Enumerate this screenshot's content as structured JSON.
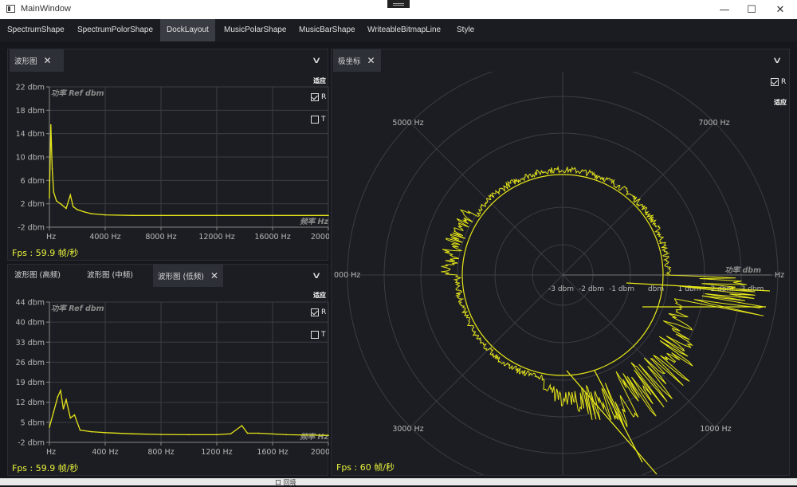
{
  "window": {
    "title": "MainWindow",
    "minimize_glyph": "—",
    "maximize_glyph": "☐",
    "close_glyph": "✕"
  },
  "menu": {
    "items": [
      {
        "label": "SpectrumShape",
        "active": false
      },
      {
        "label": "SpectrumPolorShape",
        "active": false
      },
      {
        "label": "DockLayout",
        "active": true
      },
      {
        "label": "MusicPolarShape",
        "active": false
      },
      {
        "label": "MusicBarShape",
        "active": false
      },
      {
        "label": "WriteableBitmapLine",
        "active": false
      },
      {
        "label": "Style",
        "active": false
      }
    ]
  },
  "dock": {
    "top_left": {
      "tab_label": "波形图",
      "fit_label": "适应",
      "check_r": {
        "label": "R",
        "checked": true
      },
      "check_t": {
        "label": "T",
        "checked": false
      },
      "fps_text": "Fps : 59.9 帧/秒"
    },
    "bottom_left": {
      "tabs": [
        {
          "label": "波形图 (高频)",
          "active": false
        },
        {
          "label": "波形图 (中频)",
          "active": false
        },
        {
          "label": "波形图 (低频)",
          "active": true
        }
      ],
      "fit_label": "适应",
      "check_r": {
        "label": "R",
        "checked": true
      },
      "check_t": {
        "label": "T",
        "checked": false
      },
      "fps_text": "Fps : 59.9 帧/秒"
    },
    "right": {
      "tab_label": "极坐标",
      "fit_label": "适应",
      "check_r": {
        "label": "R",
        "checked": true
      },
      "fps_text": "Fps : 60 帧/秒"
    }
  },
  "taskbar": {
    "text": "口 回境"
  },
  "colors": {
    "trace": "#e6e619",
    "fps": "#e7f23c",
    "grid": "#3b3d44",
    "axis_text": "#b8b8b8"
  },
  "chart_data": [
    {
      "type": "line",
      "ylabel": "功率 Ref dbm",
      "xlabel": "频率 Hz",
      "y_ticks": [
        "22 dbm",
        "18 dbm",
        "14 dbm",
        "10 dbm",
        "6 dbm",
        "2 dbm",
        "-2 dbm"
      ],
      "x_ticks": [
        "Hz",
        "4000 Hz",
        "8000 Hz",
        "12000 Hz",
        "16000 Hz",
        "2000"
      ],
      "xlim": [
        0,
        20000
      ],
      "ylim": [
        -2,
        22
      ],
      "grid": true,
      "series": [
        {
          "x": [
            0,
            100,
            200,
            300,
            500,
            800,
            1200,
            1500,
            1700,
            2000,
            2500,
            3000,
            4000,
            6000,
            8000,
            12000,
            16000,
            20000
          ],
          "values": [
            3,
            15.5,
            8,
            4,
            2.5,
            2,
            1.2,
            3.5,
            1.5,
            1,
            0.6,
            0.3,
            0.1,
            0,
            0,
            0,
            0,
            0
          ]
        }
      ]
    },
    {
      "type": "line",
      "ylabel": "功率 Ref dbm",
      "xlabel": "频率 Hz",
      "y_ticks": [
        "44 dbm",
        "40 dbm",
        "33 dbm",
        "26 dbm",
        "19 dbm",
        "12 dbm",
        "5 dbm",
        "-2 dbm"
      ],
      "x_ticks": [
        "Hz",
        "400 Hz",
        "800 Hz",
        "1200 Hz",
        "1600 Hz",
        "2000"
      ],
      "xlim": [
        0,
        2000
      ],
      "ylim": [
        -2,
        44
      ],
      "grid": true,
      "series": [
        {
          "x": [
            0,
            30,
            60,
            80,
            100,
            120,
            150,
            180,
            220,
            300,
            400,
            600,
            800,
            1000,
            1200,
            1300,
            1380,
            1420,
            1500,
            1700,
            2000
          ],
          "values": [
            3,
            8,
            13,
            15,
            9,
            12,
            6,
            7,
            2,
            1.5,
            1.2,
            0.8,
            0.6,
            0.5,
            0.5,
            0.8,
            3.5,
            1,
            1,
            0.5,
            0.3
          ]
        }
      ]
    },
    {
      "type": "line",
      "polar": true,
      "ylabel": "功率 dbm",
      "xlabel": "Hz",
      "r_ticks": [
        "-3 dbm",
        "-2 dbm",
        "-1 dbm",
        "dbm",
        "1 dbm",
        "2 dbm",
        "3 dbm"
      ],
      "angle_labels": [
        "5000 Hz",
        "7000 Hz",
        "000 Hz",
        "Hz",
        "3000 Hz",
        "1000 Hz"
      ]
    }
  ]
}
